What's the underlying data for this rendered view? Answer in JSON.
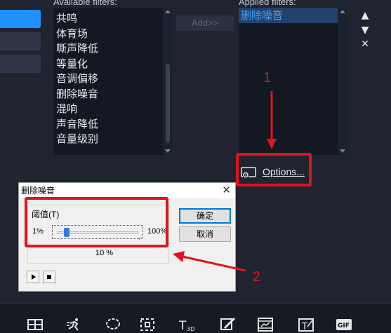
{
  "available": {
    "label": "Available filters:",
    "items": [
      "共鸣",
      "体育场",
      "嘶声降低",
      "等量化",
      "音调偏移",
      "删除噪音",
      "混响",
      "声音降低",
      "音量级别"
    ]
  },
  "add_button": "Add>>",
  "applied": {
    "label": "Applied filters:",
    "items": [
      "删除噪音"
    ]
  },
  "controls": {
    "move_up": "▲",
    "move_down": "▼",
    "remove": "✕"
  },
  "options_button": "Options...",
  "annotations": {
    "step1": "1",
    "step2": "2",
    "color": "#e0141c"
  },
  "dialog": {
    "title": "删除噪音",
    "close": "✕",
    "group_label": "阈值(T)",
    "slider_min": "1%",
    "slider_max": "100%",
    "slider_value": "10 %",
    "slider_level_percent": 10,
    "ok": "确定",
    "cancel": "取消",
    "play_icon": "play-icon",
    "stop_icon": "stop-icon"
  },
  "colors": {
    "accent": "#1e90ff",
    "selection_text": "#3fa3ff",
    "panel_bg": "#1f2430",
    "list_bg": "#131823"
  },
  "toolbar_icons": [
    "grid-icon",
    "motion-icon",
    "lasso-icon",
    "crop-icon",
    "title-3d-icon",
    "paint-icon",
    "filmstrip-icon",
    "text-fx-icon",
    "gif-icon"
  ]
}
